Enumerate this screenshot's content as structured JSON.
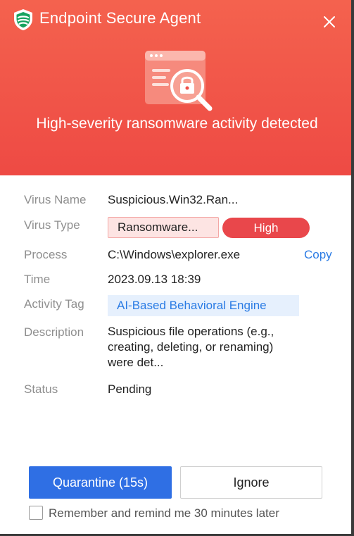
{
  "window": {
    "app_title": "Endpoint Secure Agent"
  },
  "alert": {
    "headline": "High-severity ransomware activity detected"
  },
  "details": {
    "virus_name": {
      "label": "Virus Name",
      "value": "Suspicious.Win32.Ran..."
    },
    "virus_type": {
      "label": "Virus Type",
      "value": "Ransomware...",
      "severity": "High"
    },
    "process": {
      "label": "Process",
      "value": "C:\\Windows\\explorer.exe",
      "copy_label": "Copy"
    },
    "time": {
      "label": "Time",
      "value": "2023.09.13 18:39"
    },
    "activity_tag": {
      "label": "Activity Tag",
      "value": "AI-Based Behavioral Engine"
    },
    "description": {
      "label": "Description",
      "lines": [
        "Suspicious file operations (e.g.,",
        "creating, deleting, or renaming)",
        "were det..."
      ]
    },
    "status": {
      "label": "Status",
      "value": "Pending"
    }
  },
  "actions": {
    "primary_label": "Quarantine (15s)",
    "secondary_label": "Ignore",
    "remember_label": "Remember and remind me 30 minutes later",
    "remember_checked": false
  },
  "colors": {
    "header_red": "#ef5049",
    "severity_red": "#e9474b",
    "primary_blue": "#2f6fe4",
    "link_blue": "#2a7be4"
  },
  "icons": {
    "logo": "shield-logo-icon",
    "close": "close-icon",
    "illustration": "browser-lock-magnifier-icon"
  }
}
